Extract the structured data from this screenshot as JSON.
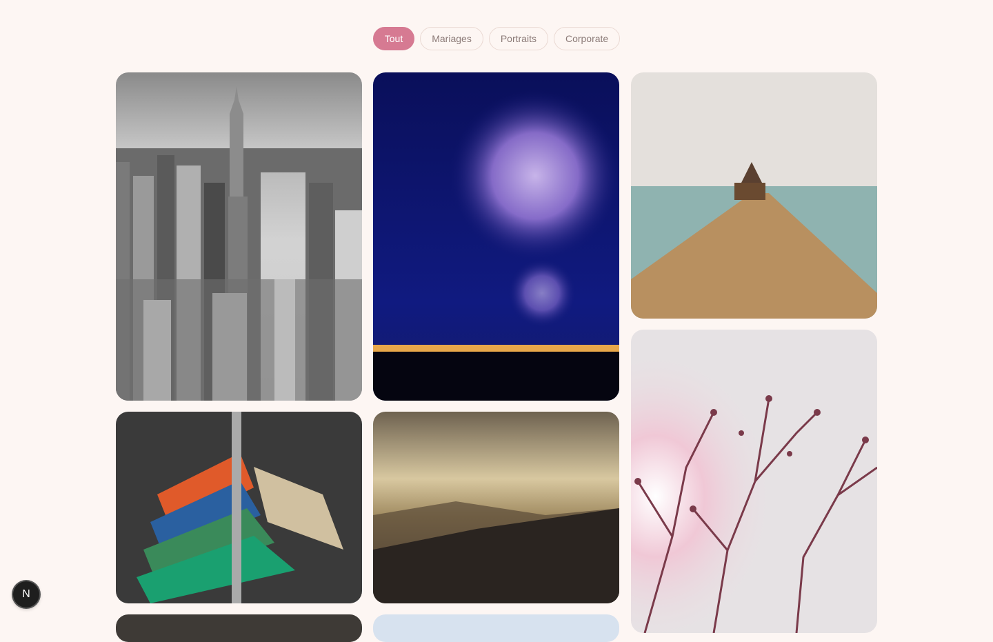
{
  "filters": {
    "items": [
      {
        "label": "Tout",
        "active": true
      },
      {
        "label": "Mariages",
        "active": false
      },
      {
        "label": "Portraits",
        "active": false
      },
      {
        "label": "Corporate",
        "active": false
      }
    ]
  },
  "gallery": {
    "photos": [
      {
        "subject": "city-skyline-bw"
      },
      {
        "subject": "fireworks-night"
      },
      {
        "subject": "wooden-pier-sea"
      },
      {
        "subject": "clothes-rack-hangers"
      },
      {
        "subject": "misty-mountain-sunset"
      },
      {
        "subject": "pink-tree-branches"
      },
      {
        "subject": "portrait-partial"
      },
      {
        "subject": "sky-partial"
      }
    ]
  },
  "devtools": {
    "badge_letter": "N"
  },
  "colors": {
    "background": "#fdf6f3",
    "accent": "#d67a92",
    "pill_border": "#ead9d3",
    "pill_text": "#8c7b78"
  }
}
